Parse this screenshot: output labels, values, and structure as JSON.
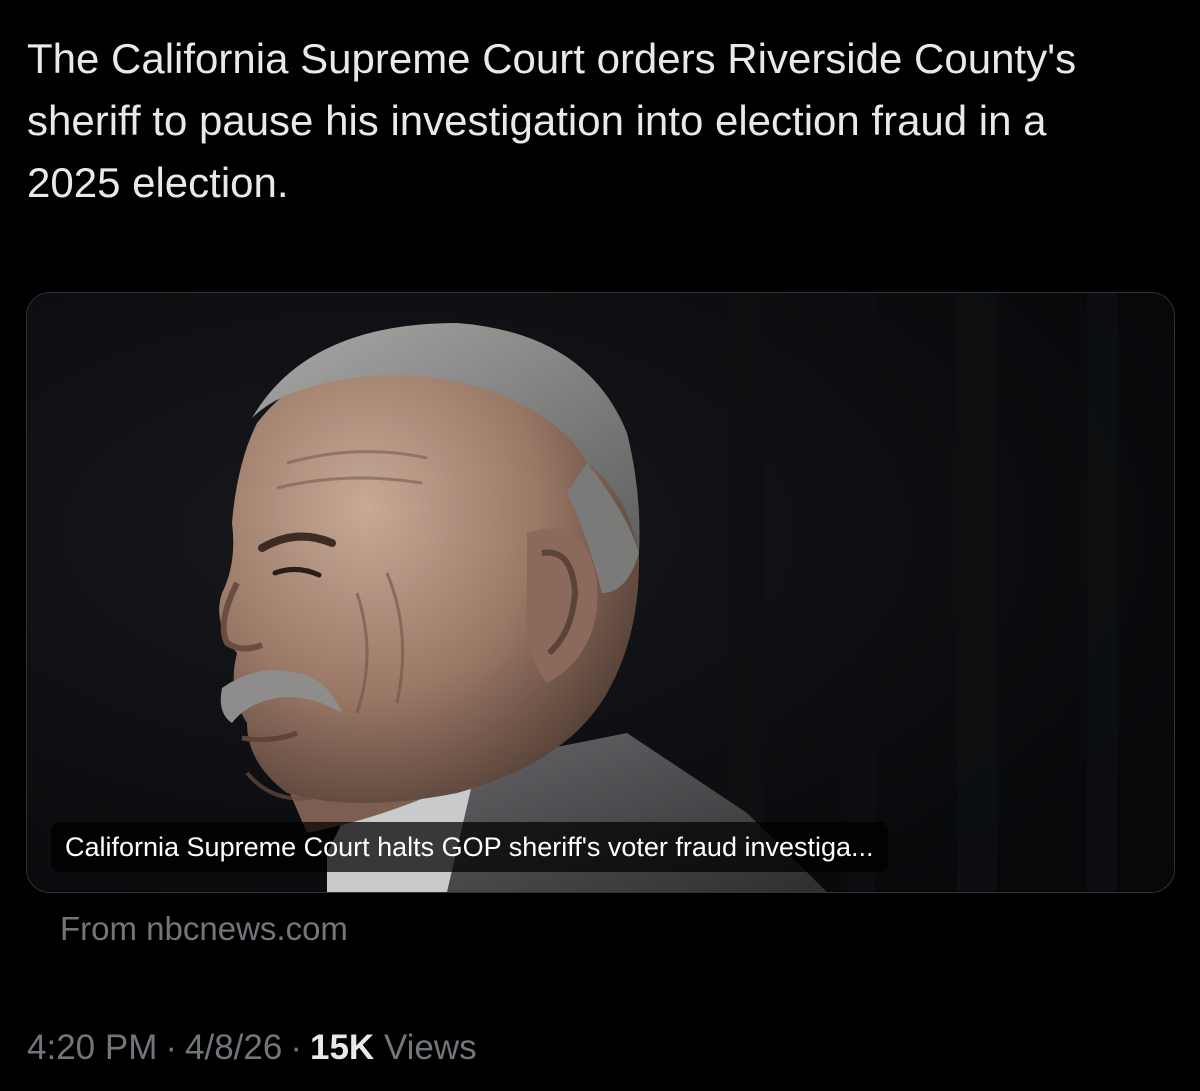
{
  "post": {
    "text": "The California Supreme Court orders Riverside County's sheriff to pause his investigation into election fraud in a 2025 election."
  },
  "link_card": {
    "photo_icon": "portrait-photo",
    "headline": "California Supreme Court halts GOP sheriff's voter fraud investiga...",
    "source": "From nbcnews.com"
  },
  "meta": {
    "time": "4:20 PM",
    "separator": "·",
    "date": "4/8/26",
    "views_count": "15K",
    "views_label": "Views"
  },
  "colors": {
    "background": "#000000",
    "text_primary": "#e7e9ea",
    "text_secondary": "#71767b",
    "card_border": "#2f3336"
  }
}
